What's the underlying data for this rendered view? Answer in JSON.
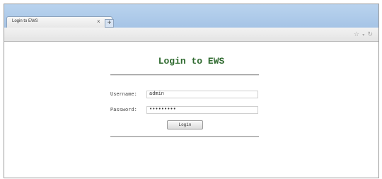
{
  "browser": {
    "tab_title": "Login to EWS",
    "tab_close": "×",
    "new_tab": "+",
    "icons": [
      "star-icon",
      "chevron-down-icon",
      "reload-icon"
    ]
  },
  "page": {
    "title": "Login to EWS",
    "username_label": "Username:",
    "username_value": "admin",
    "password_label": "Password:",
    "password_value": "•••••••••",
    "login_button": "Login"
  }
}
